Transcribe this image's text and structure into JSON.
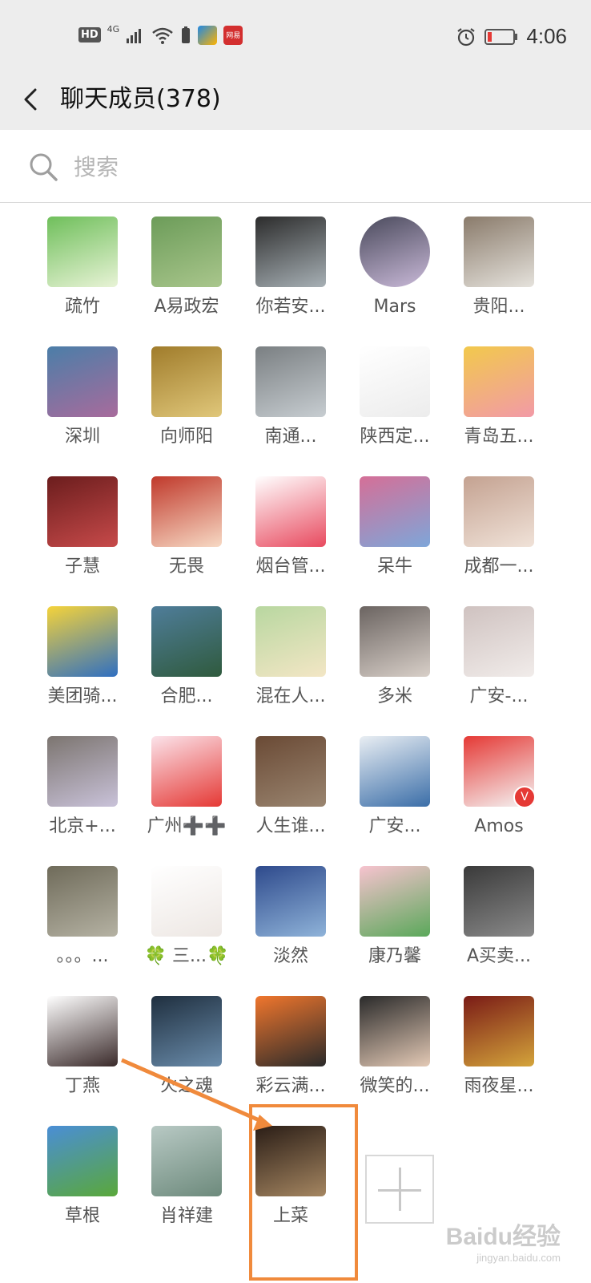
{
  "status_bar": {
    "hd": "HD",
    "network": "4G",
    "app2_text": "网易",
    "time": "4:06"
  },
  "header": {
    "title": "聊天成员(378)"
  },
  "search": {
    "placeholder": "搜索"
  },
  "members": [
    {
      "name": "疏竹",
      "colors": [
        "#6fbf5b",
        "#e8f3d6"
      ]
    },
    {
      "name": "A易政宏",
      "colors": [
        "#6c9c59",
        "#a9c68c"
      ]
    },
    {
      "name": "你若安...",
      "colors": [
        "#2c2c2c",
        "#a7b0b5"
      ]
    },
    {
      "name": "Mars",
      "colors": [
        "#4a4a5c",
        "#c9b9d8"
      ]
    },
    {
      "name": "贵阳...",
      "colors": [
        "#8a7b6b",
        "#e5e2dc"
      ]
    },
    {
      "name": "深圳",
      "colors": [
        "#4b7ea8",
        "#a86b9c"
      ]
    },
    {
      "name": "向师阳",
      "colors": [
        "#a07c2b",
        "#e0c77a"
      ]
    },
    {
      "name": "南通...",
      "colors": [
        "#7a7f82",
        "#c7cdd1"
      ]
    },
    {
      "name": "陕西定...",
      "colors": [
        "#ffffff",
        "#ececec"
      ]
    },
    {
      "name": "青岛五...",
      "colors": [
        "#f2c94c",
        "#f29aa7"
      ]
    },
    {
      "name": "子慧",
      "colors": [
        "#6b1d1d",
        "#c74a4a"
      ]
    },
    {
      "name": "无畏",
      "colors": [
        "#c0392b",
        "#f7d9c4"
      ]
    },
    {
      "name": "烟台管...",
      "colors": [
        "#ffffff",
        "#e84a5f"
      ]
    },
    {
      "name": "呆牛",
      "colors": [
        "#d56f97",
        "#7ea6d9"
      ]
    },
    {
      "name": "成都一...",
      "colors": [
        "#c4a291",
        "#f0e2d8"
      ]
    },
    {
      "name": "美团骑...",
      "colors": [
        "#f5d33a",
        "#2f6fc1"
      ]
    },
    {
      "name": "合肥...",
      "colors": [
        "#4f7d9a",
        "#2f5a3d"
      ]
    },
    {
      "name": "混在人...",
      "colors": [
        "#b8d7a0",
        "#f3e6c5"
      ]
    },
    {
      "name": "多米",
      "colors": [
        "#6b6461",
        "#d8cfc8"
      ]
    },
    {
      "name": "广安-...",
      "colors": [
        "#cfc2c0",
        "#f1ecea"
      ]
    },
    {
      "name": "北京+...",
      "colors": [
        "#7c7570",
        "#c9c2d9"
      ]
    },
    {
      "name": "广州➕➕",
      "colors": [
        "#fbe3ea",
        "#e53935"
      ]
    },
    {
      "name": "人生谁...",
      "colors": [
        "#6a4a35",
        "#9a8570"
      ]
    },
    {
      "name": "广安...",
      "colors": [
        "#e9eef3",
        "#3b6ea8"
      ]
    },
    {
      "name": "Amos",
      "colors": [
        "#e53935",
        "#f5f5f5"
      ]
    },
    {
      "name": "。。。...",
      "colors": [
        "#6f6b5a",
        "#b5b2a3"
      ]
    },
    {
      "name": "🍀 三...🍀",
      "colors": [
        "#ffffff",
        "#ede7e3"
      ]
    },
    {
      "name": "淡然",
      "colors": [
        "#2e4a8c",
        "#8fb3d9"
      ]
    },
    {
      "name": "康乃馨",
      "colors": [
        "#f7c3cf",
        "#5aa85a"
      ]
    },
    {
      "name": "A买卖...",
      "colors": [
        "#3a3a3a",
        "#8a8a8a"
      ]
    },
    {
      "name": "丁燕",
      "colors": [
        "#ffffff",
        "#3a2a2a"
      ]
    },
    {
      "name": "火之魂",
      "colors": [
        "#1f2f3f",
        "#6a8cab"
      ]
    },
    {
      "name": "彩云满...",
      "colors": [
        "#f0762d",
        "#2a2a2a"
      ]
    },
    {
      "name": "微笑的...",
      "colors": [
        "#2a2a2a",
        "#e3c9b5"
      ]
    },
    {
      "name": "雨夜星...",
      "colors": [
        "#7a1b16",
        "#d4a43b"
      ]
    },
    {
      "name": "草根",
      "colors": [
        "#4a8ed6",
        "#5aa83a"
      ]
    },
    {
      "name": "肖祥建",
      "colors": [
        "#b8c9c4",
        "#6d8a7c"
      ]
    },
    {
      "name": "上菜",
      "colors": [
        "#2a1d16",
        "#a58661"
      ]
    }
  ],
  "watermark": {
    "text": "Baidu经验",
    "sub": "jingyan.baidu.com"
  }
}
